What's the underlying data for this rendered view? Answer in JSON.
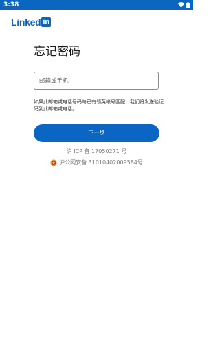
{
  "status_bar": {
    "time": "3:38"
  },
  "logo": {
    "text": "Linked",
    "box_text": "in"
  },
  "page": {
    "title": "忘记密码",
    "input_placeholder": "邮箱或手机",
    "help_text": "如果此邮箱或电话号码与已有领英帐号匹配，我们将发送验证码到此邮箱或电话。",
    "next_button": "下一步"
  },
  "footer": {
    "icp": "沪 ICP 备 17050271 号",
    "police_record": "沪公网安备 31010402009584号"
  },
  "colors": {
    "brand": "#0a66c2",
    "status_bar": "#0b66c2",
    "muted_text": "#7a7a7a"
  },
  "icons": [
    "wifi-icon",
    "battery-icon",
    "police-badge-icon"
  ]
}
